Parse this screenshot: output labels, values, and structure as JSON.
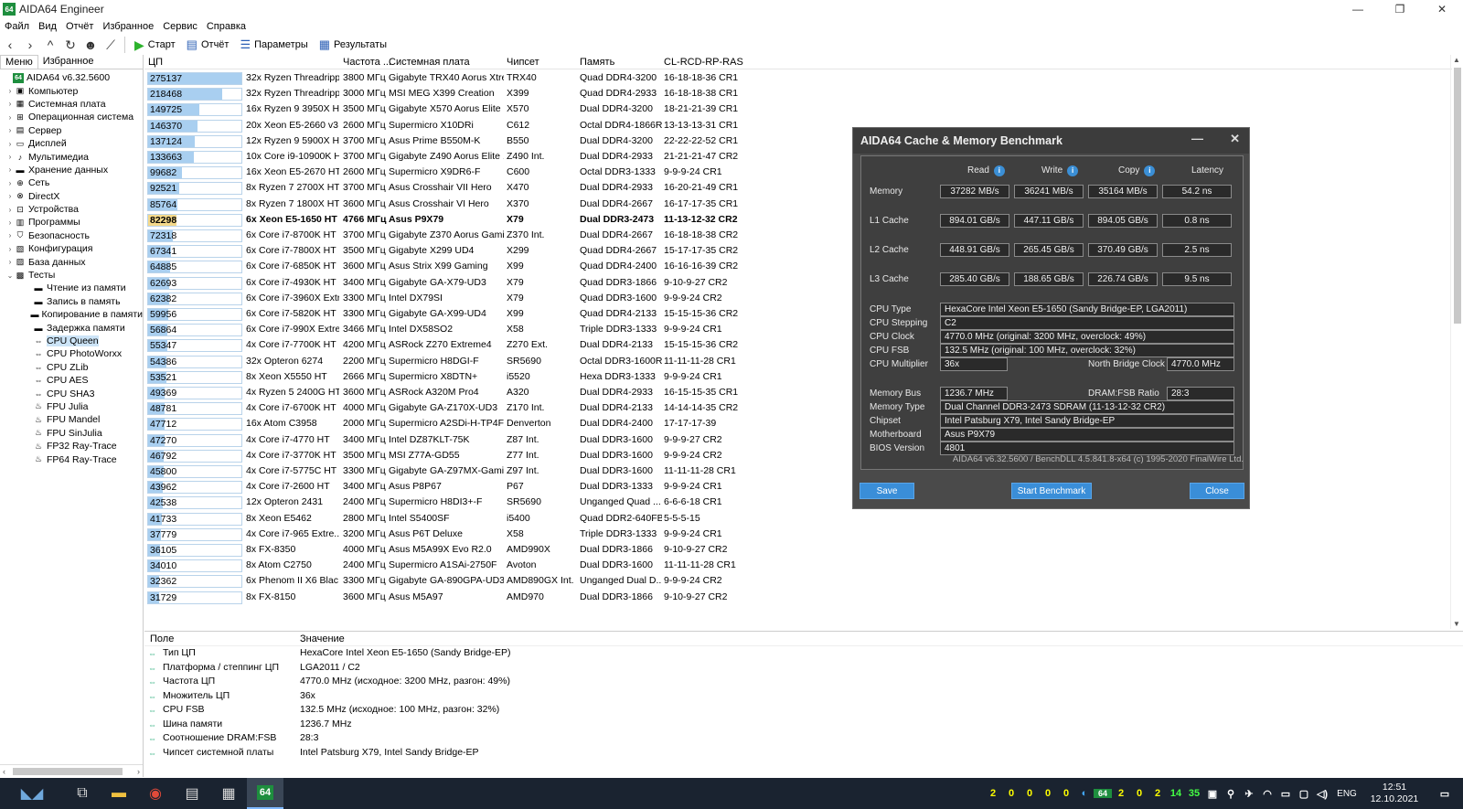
{
  "window": {
    "title": "AIDA64 Engineer",
    "app_icon": "64"
  },
  "menu": [
    "Файл",
    "Вид",
    "Отчёт",
    "Избранное",
    "Сервис",
    "Справка"
  ],
  "toolbar": {
    "start": "Старт",
    "report": "Отчёт",
    "params": "Параметры",
    "results": "Результаты"
  },
  "left_tabs": [
    "Меню",
    "Избранное"
  ],
  "tree": [
    {
      "label": "AIDA64 v6.32.5600",
      "icon": "64",
      "level": 0,
      "exp": ""
    },
    {
      "label": "Компьютер",
      "icon": "▣",
      "level": 1,
      "exp": "›"
    },
    {
      "label": "Системная плата",
      "icon": "▦",
      "level": 1,
      "exp": "›"
    },
    {
      "label": "Операционная система",
      "icon": "⊞",
      "level": 1,
      "exp": "›"
    },
    {
      "label": "Сервер",
      "icon": "▤",
      "level": 1,
      "exp": "›"
    },
    {
      "label": "Дисплей",
      "icon": "▭",
      "level": 1,
      "exp": "›"
    },
    {
      "label": "Мультимедиа",
      "icon": "♪",
      "level": 1,
      "exp": "›"
    },
    {
      "label": "Хранение данных",
      "icon": "▬",
      "level": 1,
      "exp": "›"
    },
    {
      "label": "Сеть",
      "icon": "⊕",
      "level": 1,
      "exp": "›"
    },
    {
      "label": "DirectX",
      "icon": "⊗",
      "level": 1,
      "exp": "›"
    },
    {
      "label": "Устройства",
      "icon": "⊡",
      "level": 1,
      "exp": "›"
    },
    {
      "label": "Программы",
      "icon": "▥",
      "level": 1,
      "exp": "›"
    },
    {
      "label": "Безопасность",
      "icon": "⛉",
      "level": 1,
      "exp": "›"
    },
    {
      "label": "Конфигурация",
      "icon": "▧",
      "level": 1,
      "exp": "›"
    },
    {
      "label": "База данных",
      "icon": "▨",
      "level": 1,
      "exp": "›"
    },
    {
      "label": "Тесты",
      "icon": "▩",
      "level": 1,
      "exp": "⌄"
    },
    {
      "label": "Чтение из памяти",
      "icon": "▬",
      "level": 2,
      "exp": ""
    },
    {
      "label": "Запись в память",
      "icon": "▬",
      "level": 2,
      "exp": ""
    },
    {
      "label": "Копирование в памяти",
      "icon": "▬",
      "level": 2,
      "exp": ""
    },
    {
      "label": "Задержка памяти",
      "icon": "▬",
      "level": 2,
      "exp": ""
    },
    {
      "label": "CPU Queen",
      "icon": "⇔",
      "level": 2,
      "exp": "",
      "selected": true
    },
    {
      "label": "CPU PhotoWorxx",
      "icon": "⇔",
      "level": 2,
      "exp": ""
    },
    {
      "label": "CPU ZLib",
      "icon": "⇔",
      "level": 2,
      "exp": ""
    },
    {
      "label": "CPU AES",
      "icon": "⇔",
      "level": 2,
      "exp": ""
    },
    {
      "label": "CPU SHA3",
      "icon": "⇔",
      "level": 2,
      "exp": ""
    },
    {
      "label": "FPU Julia",
      "icon": "♨",
      "level": 2,
      "exp": ""
    },
    {
      "label": "FPU Mandel",
      "icon": "♨",
      "level": 2,
      "exp": ""
    },
    {
      "label": "FPU SinJulia",
      "icon": "♨",
      "level": 2,
      "exp": ""
    },
    {
      "label": "FP32 Ray-Trace",
      "icon": "♨",
      "level": 2,
      "exp": ""
    },
    {
      "label": "FP64 Ray-Trace",
      "icon": "♨",
      "level": 2,
      "exp": ""
    }
  ],
  "grid": {
    "headers": [
      "ЦП",
      "Частота ...",
      "Системная плата",
      "Чипсет",
      "Память",
      "CL-RCD-RP-RAS"
    ],
    "max": 275137,
    "rows": [
      {
        "score": 275137,
        "cpu": "32x Ryzen Threadripp...",
        "freq": "3800 МГц",
        "board": "Gigabyte TRX40 Aorus Xtre...",
        "chipset": "TRX40",
        "mem": "Quad DDR4-3200",
        "timing": "16-18-18-36 CR1"
      },
      {
        "score": 218468,
        "cpu": "32x Ryzen Threadripp...",
        "freq": "3000 МГц",
        "board": "MSI MEG X399 Creation",
        "chipset": "X399",
        "mem": "Quad DDR4-2933",
        "timing": "16-18-18-38 CR1"
      },
      {
        "score": 149725,
        "cpu": "16x Ryzen 9 3950X HT",
        "freq": "3500 МГц",
        "board": "Gigabyte X570 Aorus Elite",
        "chipset": "X570",
        "mem": "Dual DDR4-3200",
        "timing": "18-21-21-39 CR1"
      },
      {
        "score": 146370,
        "cpu": "20x Xeon E5-2660 v3 ...",
        "freq": "2600 МГц",
        "board": "Supermicro X10DRi",
        "chipset": "C612",
        "mem": "Octal DDR4-1866R",
        "timing": "13-13-13-31 CR1"
      },
      {
        "score": 137124,
        "cpu": "12x Ryzen 9 5900X HT",
        "freq": "3700 МГц",
        "board": "Asus Prime B550M-K",
        "chipset": "B550",
        "mem": "Dual DDR4-3200",
        "timing": "22-22-22-52 CR1"
      },
      {
        "score": 133663,
        "cpu": "10x Core i9-10900K HT",
        "freq": "3700 МГц",
        "board": "Gigabyte Z490 Aorus Elite ...",
        "chipset": "Z490 Int.",
        "mem": "Dual DDR4-2933",
        "timing": "21-21-21-47 CR2"
      },
      {
        "score": 99682,
        "cpu": "16x Xeon E5-2670 HT",
        "freq": "2600 МГц",
        "board": "Supermicro X9DR6-F",
        "chipset": "C600",
        "mem": "Octal DDR3-1333",
        "timing": "9-9-9-24 CR1"
      },
      {
        "score": 92521,
        "cpu": "8x Ryzen 7 2700X HT",
        "freq": "3700 МГц",
        "board": "Asus Crosshair VII Hero",
        "chipset": "X470",
        "mem": "Dual DDR4-2933",
        "timing": "16-20-21-49 CR1"
      },
      {
        "score": 85764,
        "cpu": "8x Ryzen 7 1800X HT",
        "freq": "3600 МГц",
        "board": "Asus Crosshair VI Hero",
        "chipset": "X370",
        "mem": "Dual DDR4-2667",
        "timing": "16-17-17-35 CR1"
      },
      {
        "score": 82298,
        "cpu": "6x Xeon E5-1650 HT",
        "freq": "4766 МГц",
        "board": "Asus P9X79",
        "chipset": "X79",
        "mem": "Dual DDR3-2473",
        "timing": "11-13-12-32 CR2",
        "highlight": true
      },
      {
        "score": 72318,
        "cpu": "6x Core i7-8700K HT",
        "freq": "3700 МГц",
        "board": "Gigabyte Z370 Aorus Gami...",
        "chipset": "Z370 Int.",
        "mem": "Dual DDR4-2667",
        "timing": "16-18-18-38 CR2"
      },
      {
        "score": 67341,
        "cpu": "6x Core i7-7800X HT",
        "freq": "3500 МГц",
        "board": "Gigabyte X299 UD4",
        "chipset": "X299",
        "mem": "Quad DDR4-2667",
        "timing": "15-17-17-35 CR2"
      },
      {
        "score": 64885,
        "cpu": "6x Core i7-6850K HT",
        "freq": "3600 МГц",
        "board": "Asus Strix X99 Gaming",
        "chipset": "X99",
        "mem": "Quad DDR4-2400",
        "timing": "16-16-16-39 CR2"
      },
      {
        "score": 62693,
        "cpu": "6x Core i7-4930K HT",
        "freq": "3400 МГц",
        "board": "Gigabyte GA-X79-UD3",
        "chipset": "X79",
        "mem": "Quad DDR3-1866",
        "timing": "9-10-9-27 CR2"
      },
      {
        "score": 62382,
        "cpu": "6x Core i7-3960X Extr...",
        "freq": "3300 МГц",
        "board": "Intel DX79SI",
        "chipset": "X79",
        "mem": "Quad DDR3-1600",
        "timing": "9-9-9-24 CR2"
      },
      {
        "score": 59956,
        "cpu": "6x Core i7-5820K HT",
        "freq": "3300 МГц",
        "board": "Gigabyte GA-X99-UD4",
        "chipset": "X99",
        "mem": "Quad DDR4-2133",
        "timing": "15-15-15-36 CR2"
      },
      {
        "score": 56864,
        "cpu": "6x Core i7-990X Extre...",
        "freq": "3466 МГц",
        "board": "Intel DX58SO2",
        "chipset": "X58",
        "mem": "Triple DDR3-1333",
        "timing": "9-9-9-24 CR1"
      },
      {
        "score": 55347,
        "cpu": "4x Core i7-7700K HT",
        "freq": "4200 МГц",
        "board": "ASRock Z270 Extreme4",
        "chipset": "Z270 Ext.",
        "mem": "Dual DDR4-2133",
        "timing": "15-15-15-36 CR2"
      },
      {
        "score": 54386,
        "cpu": "32x Opteron 6274",
        "freq": "2200 МГц",
        "board": "Supermicro H8DGI-F",
        "chipset": "SR5690",
        "mem": "Octal DDR3-1600R",
        "timing": "11-11-11-28 CR1"
      },
      {
        "score": 53521,
        "cpu": "8x Xeon X5550 HT",
        "freq": "2666 МГц",
        "board": "Supermicro X8DTN+",
        "chipset": "i5520",
        "mem": "Hexa DDR3-1333",
        "timing": "9-9-9-24 CR1"
      },
      {
        "score": 49369,
        "cpu": "4x Ryzen 5 2400G HT",
        "freq": "3600 МГц",
        "board": "ASRock A320M Pro4",
        "chipset": "A320",
        "mem": "Dual DDR4-2933",
        "timing": "16-15-15-35 CR1"
      },
      {
        "score": 48781,
        "cpu": "4x Core i7-6700K HT",
        "freq": "4000 МГц",
        "board": "Gigabyte GA-Z170X-UD3",
        "chipset": "Z170 Int.",
        "mem": "Dual DDR4-2133",
        "timing": "14-14-14-35 CR2"
      },
      {
        "score": 47712,
        "cpu": "16x Atom C3958",
        "freq": "2000 МГц",
        "board": "Supermicro A2SDi-H-TP4F",
        "chipset": "Denverton",
        "mem": "Dual DDR4-2400",
        "timing": "17-17-17-39"
      },
      {
        "score": 47270,
        "cpu": "4x Core i7-4770 HT",
        "freq": "3400 МГц",
        "board": "Intel DZ87KLT-75K",
        "chipset": "Z87 Int.",
        "mem": "Dual DDR3-1600",
        "timing": "9-9-9-27 CR2"
      },
      {
        "score": 46792,
        "cpu": "4x Core i7-3770K HT",
        "freq": "3500 МГц",
        "board": "MSI Z77A-GD55",
        "chipset": "Z77 Int.",
        "mem": "Dual DDR3-1600",
        "timing": "9-9-9-24 CR2"
      },
      {
        "score": 45800,
        "cpu": "4x Core i7-5775C HT",
        "freq": "3300 МГц",
        "board": "Gigabyte GA-Z97MX-Gami...",
        "chipset": "Z97 Int.",
        "mem": "Dual DDR3-1600",
        "timing": "11-11-11-28 CR1"
      },
      {
        "score": 43962,
        "cpu": "4x Core i7-2600 HT",
        "freq": "3400 МГц",
        "board": "Asus P8P67",
        "chipset": "P67",
        "mem": "Dual DDR3-1333",
        "timing": "9-9-9-24 CR1"
      },
      {
        "score": 42538,
        "cpu": "12x Opteron 2431",
        "freq": "2400 МГц",
        "board": "Supermicro H8DI3+-F",
        "chipset": "SR5690",
        "mem": "Unganged Quad ...",
        "timing": "6-6-6-18 CR1"
      },
      {
        "score": 41733,
        "cpu": "8x Xeon E5462",
        "freq": "2800 МГц",
        "board": "Intel S5400SF",
        "chipset": "i5400",
        "mem": "Quad DDR2-640FB",
        "timing": "5-5-5-15"
      },
      {
        "score": 37779,
        "cpu": "4x Core i7-965 Extre...",
        "freq": "3200 МГц",
        "board": "Asus P6T Deluxe",
        "chipset": "X58",
        "mem": "Triple DDR3-1333",
        "timing": "9-9-9-24 CR1"
      },
      {
        "score": 36105,
        "cpu": "8x FX-8350",
        "freq": "4000 МГц",
        "board": "Asus M5A99X Evo R2.0",
        "chipset": "AMD990X",
        "mem": "Dual DDR3-1866",
        "timing": "9-10-9-27 CR2"
      },
      {
        "score": 34010,
        "cpu": "8x Atom C2750",
        "freq": "2400 МГц",
        "board": "Supermicro A1SAi-2750F",
        "chipset": "Avoton",
        "mem": "Dual DDR3-1600",
        "timing": "11-11-11-28 CR1"
      },
      {
        "score": 32362,
        "cpu": "6x Phenom II X6 Blac...",
        "freq": "3300 МГц",
        "board": "Gigabyte GA-890GPA-UD3...",
        "chipset": "AMD890GX Int.",
        "mem": "Unganged Dual D...",
        "timing": "9-9-9-24 CR2"
      },
      {
        "score": 31729,
        "cpu": "8x FX-8150",
        "freq": "3600 МГц",
        "board": "Asus M5A97",
        "chipset": "AMD970",
        "mem": "Dual DDR3-1866",
        "timing": "9-10-9-27 CR2"
      }
    ]
  },
  "details": {
    "headers": [
      "Поле",
      "Значение"
    ],
    "rows": [
      {
        "field": "Тип ЦП",
        "value": "HexaCore Intel Xeon E5-1650  (Sandy Bridge-EP)"
      },
      {
        "field": "Платформа / степпинг ЦП",
        "value": "LGA2011 / C2"
      },
      {
        "field": "Частота ЦП",
        "value": "4770.0 MHz  (исходное: 3200 MHz, разгон: 49%)"
      },
      {
        "field": "Множитель ЦП",
        "value": "36x"
      },
      {
        "field": "CPU FSB",
        "value": "132.5 MHz  (исходное: 100 MHz, разгон: 32%)"
      },
      {
        "field": "Шина памяти",
        "value": "1236.7 MHz"
      },
      {
        "field": "Соотношение DRAM:FSB",
        "value": "28:3"
      },
      {
        "field": "Чипсет системной платы",
        "value": "Intel Patsburg X79, Intel Sandy Bridge-EP"
      }
    ]
  },
  "dialog": {
    "title": "AIDA64 Cache & Memory Benchmark",
    "cols": [
      "Read",
      "Write",
      "Copy",
      "Latency"
    ],
    "rows": [
      {
        "label": "Memory",
        "read": "37282 MB/s",
        "write": "36241 MB/s",
        "copy": "35164 MB/s",
        "latency": "54.2 ns"
      },
      {
        "label": "L1 Cache",
        "read": "894.01 GB/s",
        "write": "447.11 GB/s",
        "copy": "894.05 GB/s",
        "latency": "0.8 ns"
      },
      {
        "label": "L2 Cache",
        "read": "448.91 GB/s",
        "write": "265.45 GB/s",
        "copy": "370.49 GB/s",
        "latency": "2.5 ns"
      },
      {
        "label": "L3 Cache",
        "read": "285.40 GB/s",
        "write": "188.65 GB/s",
        "copy": "226.74 GB/s",
        "latency": "9.5 ns"
      }
    ],
    "cpu_type_label": "CPU Type",
    "cpu_type": "HexaCore Intel Xeon E5-1650  (Sandy Bridge-EP, LGA2011)",
    "cpu_stepping_label": "CPU Stepping",
    "cpu_stepping": "C2",
    "cpu_clock_label": "CPU Clock",
    "cpu_clock": "4770.0 MHz  (original: 3200 MHz, overclock: 49%)",
    "cpu_fsb_label": "CPU FSB",
    "cpu_fsb": "132.5 MHz  (original: 100 MHz, overclock: 32%)",
    "cpu_mult_label": "CPU Multiplier",
    "cpu_mult": "36x",
    "nb_clock_label": "North Bridge Clock",
    "nb_clock": "4770.0 MHz",
    "mem_bus_label": "Memory Bus",
    "mem_bus": "1236.7 MHz",
    "dram_ratio_label": "DRAM:FSB Ratio",
    "dram_ratio": "28:3",
    "mem_type_label": "Memory Type",
    "mem_type": "Dual Channel DDR3-2473 SDRAM  (11-13-12-32 CR2)",
    "chipset_label": "Chipset",
    "chipset": "Intel Patsburg X79, Intel Sandy Bridge-EP",
    "mobo_label": "Motherboard",
    "mobo": "Asus P9X79",
    "bios_label": "BIOS Version",
    "bios": "4801",
    "footer": "AIDA64 v6.32.5600 / BenchDLL 4.5.841.8-x64  (c) 1995-2020 FinalWire Ltd.",
    "save": "Save",
    "start": "Start Benchmark",
    "close": "Close"
  },
  "tray": {
    "counters": [
      "2",
      "0",
      "0",
      "0",
      "0",
      "2",
      "0",
      "2",
      "14",
      "35"
    ],
    "lang": "ENG",
    "time": "12:51",
    "date": "12.10.2021",
    "app64": "64"
  }
}
